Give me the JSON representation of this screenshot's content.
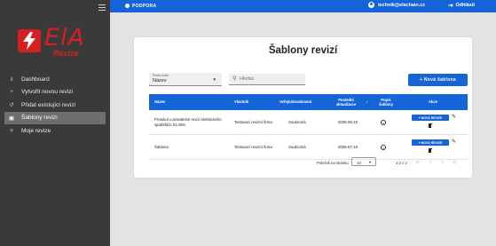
{
  "sidebar": {
    "logo_text": "ElA",
    "logo_subtitle": "Revize",
    "items": [
      {
        "label": "Dashboard",
        "icon": "bar-chart-icon",
        "glyph": "ıl",
        "active": false
      },
      {
        "label": "Vytvořit novou revizi",
        "icon": "plus-icon",
        "glyph": "+",
        "active": false
      },
      {
        "label": "Přidat existující revizi",
        "icon": "history-icon",
        "glyph": "↺",
        "active": false
      },
      {
        "label": "Šablony revizí",
        "icon": "template-icon",
        "glyph": "▣",
        "active": true
      },
      {
        "label": "Moje revize",
        "icon": "list-icon",
        "glyph": "≡",
        "active": false
      }
    ]
  },
  "topbar": {
    "support_label": "PODPORA",
    "user_email": "technik@elachain.cz",
    "logout_label": "Odhlásit"
  },
  "page": {
    "title": "Šablony revizí",
    "sort": {
      "caption": "Řadit podle",
      "value": "Název"
    },
    "search": {
      "placeholder": "Hledat"
    },
    "new_button": "+ Nová šablona"
  },
  "table": {
    "headers": {
      "name": "Název",
      "owner": "Vlastník",
      "visibility": "Veřejná/soukromá",
      "updated": "Poslední aktualizace",
      "updated_sort": "↓",
      "desc": "Popis šablony",
      "actions": "Akce"
    },
    "rows": [
      {
        "name": "Protokol o pravidelné revizi elektrického spotřebiče ELABS",
        "owner": "Testovací revizní firma",
        "visibility": "Soukromá",
        "updated": "2025-09-15",
        "info": "i",
        "action": "+ NOVÁ REVIZE"
      },
      {
        "name": "Šablona",
        "owner": "Testovací revizní firma",
        "visibility": "Soukromá",
        "updated": "2025-07-16",
        "info": "i",
        "action": "+ NOVÁ REVIZE"
      }
    ]
  },
  "pagination": {
    "per_page_label": "Položek na stránku:",
    "per_page": "10",
    "range": "1-2 z 2",
    "first": "|<",
    "prev": "<",
    "next": ">",
    "last": ">|"
  },
  "colors": {
    "primary": "#1565d8",
    "sidebar_bg": "#3a3a3a",
    "content_bg": "#e3e3e3",
    "brand_red": "#d42020"
  }
}
